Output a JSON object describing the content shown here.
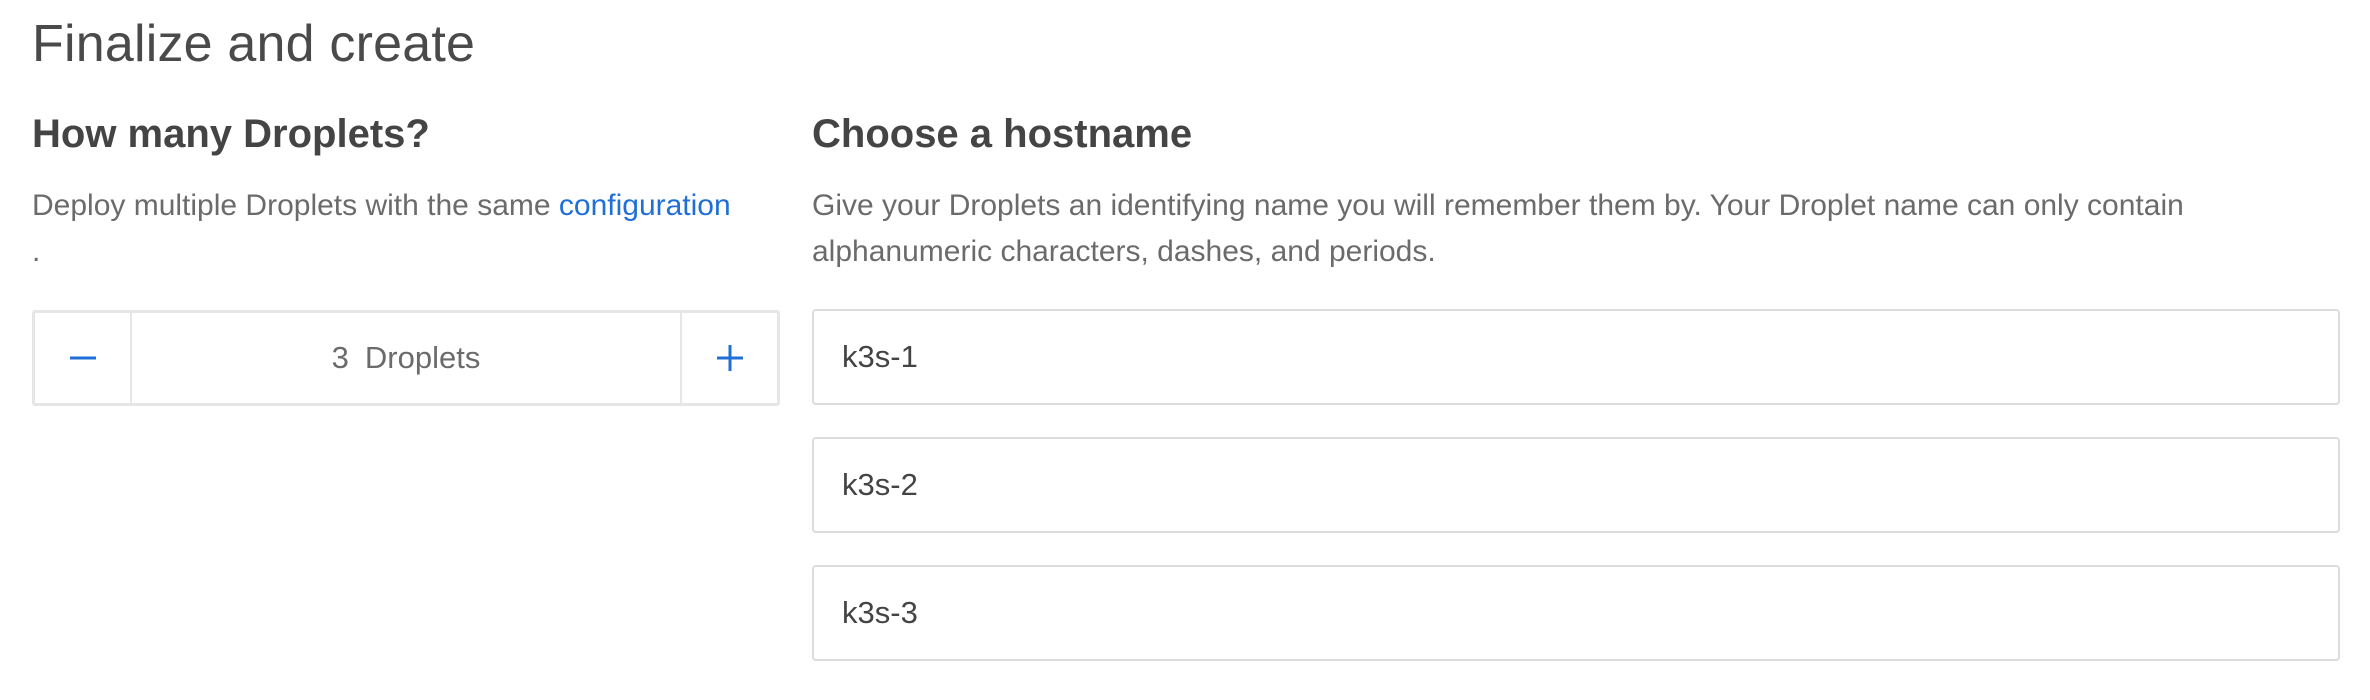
{
  "page": {
    "title": "Finalize and create"
  },
  "droplet_count": {
    "heading": "How many Droplets?",
    "description_before_link": "Deploy multiple Droplets with the same ",
    "description_link": "configuration",
    "description_after_link": ".",
    "stepper": {
      "minus_icon": "minus-icon",
      "plus_icon": "plus-icon",
      "count": "3",
      "unit": "Droplets"
    }
  },
  "hostname": {
    "heading": "Choose a hostname",
    "description": "Give your Droplets an identifying name you will remember them by. Your Droplet name can only contain alphanumeric characters, dashes, and periods.",
    "inputs": [
      {
        "value": "k3s-1"
      },
      {
        "value": "k3s-2"
      },
      {
        "value": "k3s-3"
      }
    ]
  },
  "colors": {
    "accent": "#1f6fd6",
    "border": "#e6e6e6",
    "text": "#444444",
    "muted_text": "#6b6b6b"
  }
}
